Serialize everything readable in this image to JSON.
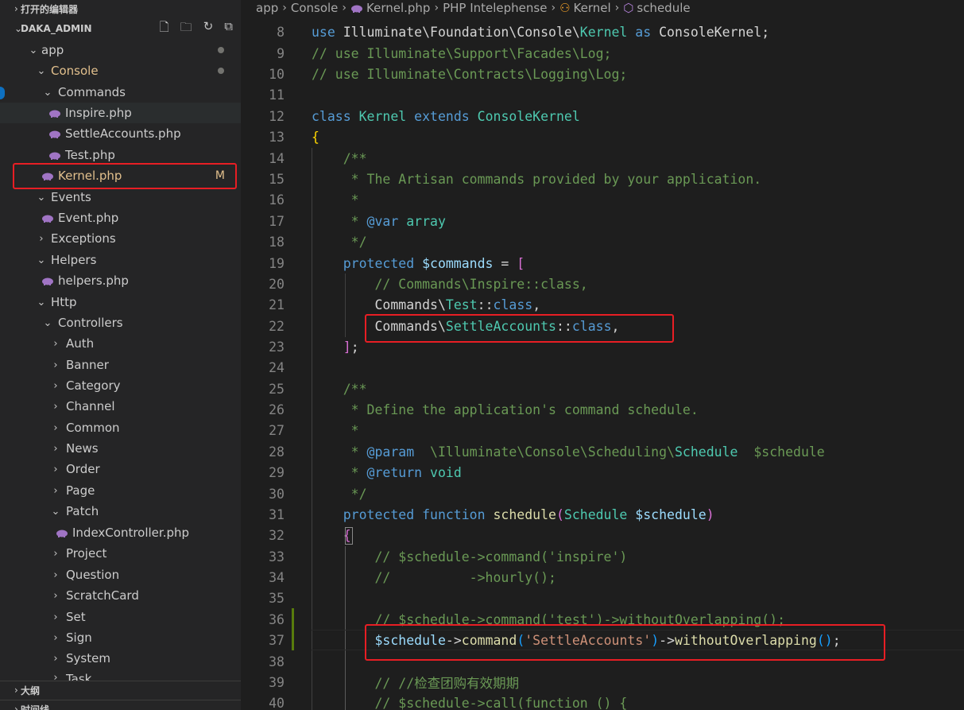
{
  "sidebar": {
    "open_editors_label": "打开的编辑器",
    "project_label": "DAKA_ADMIN",
    "outline_label": "大纲",
    "timeline_label": "时间线",
    "tree": {
      "app": "app",
      "console": "Console",
      "commands": "Commands",
      "inspire": "Inspire.php",
      "settle": "SettleAccounts.php",
      "test": "Test.php",
      "kernel": "Kernel.php",
      "kernel_status": "M",
      "events": "Events",
      "event_php": "Event.php",
      "exceptions": "Exceptions",
      "helpers": "Helpers",
      "helpers_php": "helpers.php",
      "http": "Http",
      "controllers": "Controllers",
      "auth": "Auth",
      "banner": "Banner",
      "category": "Category",
      "channel": "Channel",
      "common": "Common",
      "news": "News",
      "order": "Order",
      "page": "Page",
      "patch": "Patch",
      "index_controller": "IndexController.php",
      "project": "Project",
      "question": "Question",
      "scratchcard": "ScratchCard",
      "set": "Set",
      "sign": "Sign",
      "system": "System",
      "task": "Task"
    }
  },
  "breadcrumb": {
    "app": "app",
    "console": "Console",
    "file": "Kernel.php",
    "php": "PHP Intelephense",
    "class": "Kernel",
    "method": "schedule"
  },
  "code": {
    "l8": [
      "use",
      " Illuminate\\Foundation\\Console\\",
      "Kernel",
      " as ",
      "ConsoleKernel",
      ";"
    ],
    "l9": "// use Illuminate\\Support\\Facades\\Log;",
    "l10": "// use Illuminate\\Contracts\\Logging\\Log;",
    "l12": [
      "class",
      " Kernel ",
      "extends",
      " ConsoleKernel"
    ],
    "l13": "{",
    "l14": "    /**",
    "l15": "     * The Artisan commands provided by your application.",
    "l16": "     *",
    "l17": [
      "     * ",
      "@var",
      " array"
    ],
    "l18": "     */",
    "l19": [
      "    protected",
      " $commands",
      " = ",
      "["
    ],
    "l20": "        // Commands\\Inspire::class,",
    "l21": [
      "        Commands\\",
      "Test",
      "::",
      "class",
      ","
    ],
    "l22": [
      "        Commands\\",
      "SettleAccounts",
      "::",
      "class",
      ","
    ],
    "l23": [
      "    ",
      "]",
      ";"
    ],
    "l25": "    /**",
    "l26": "     * Define the application's command schedule.",
    "l27": "     *",
    "l28": [
      "     * ",
      "@param",
      "  \\Illuminate\\Console\\Scheduling\\",
      "Schedule",
      "  $schedule"
    ],
    "l29": [
      "     * ",
      "@return",
      " void"
    ],
    "l30": "     */",
    "l31": [
      "    protected",
      " function",
      " schedule",
      "(",
      "Schedule",
      " $schedule",
      ")"
    ],
    "l32": "    {",
    "l33": "        // $schedule->command('inspire')",
    "l34": "        //          ->hourly();",
    "l36": "        // $schedule->command('test')->withoutOverlapping();",
    "l37": [
      "        $schedule",
      "->",
      "command",
      "(",
      "'SettleAccounts'",
      ")",
      "->",
      "withoutOverlapping",
      "()",
      ";"
    ],
    "l39": "        // //检查团购有效期期",
    "l40": "        // $schedule->call(function () {"
  }
}
